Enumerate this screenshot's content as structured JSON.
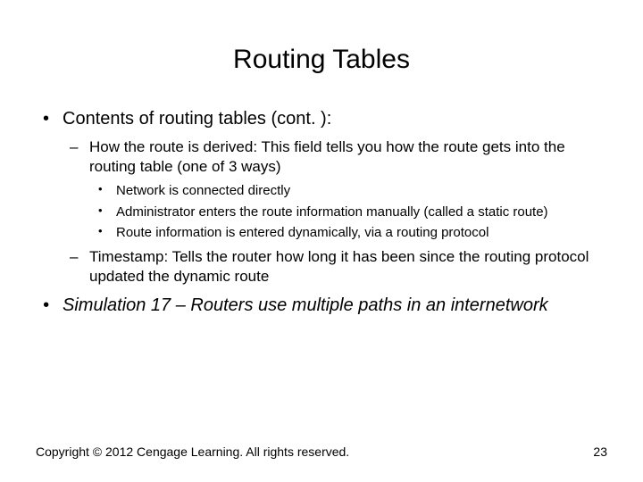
{
  "title": "Routing Tables",
  "bullets": {
    "b1": "Contents of routing tables (cont. ):",
    "b1_1": "How the route is derived: This field tells you how the route gets into the routing table (one of 3 ways)",
    "b1_1_1": "Network is connected directly",
    "b1_1_2": "Administrator enters the route information manually (called a static route)",
    "b1_1_3": "Route information is entered dynamically, via a routing protocol",
    "b1_2": "Timestamp: Tells the router how long it has been since the routing protocol updated the dynamic route",
    "b2": "Simulation 17 – Routers use multiple paths in an internetwork"
  },
  "footer": {
    "copyright": "Copyright © 2012 Cengage Learning. All rights reserved.",
    "page": "23"
  }
}
